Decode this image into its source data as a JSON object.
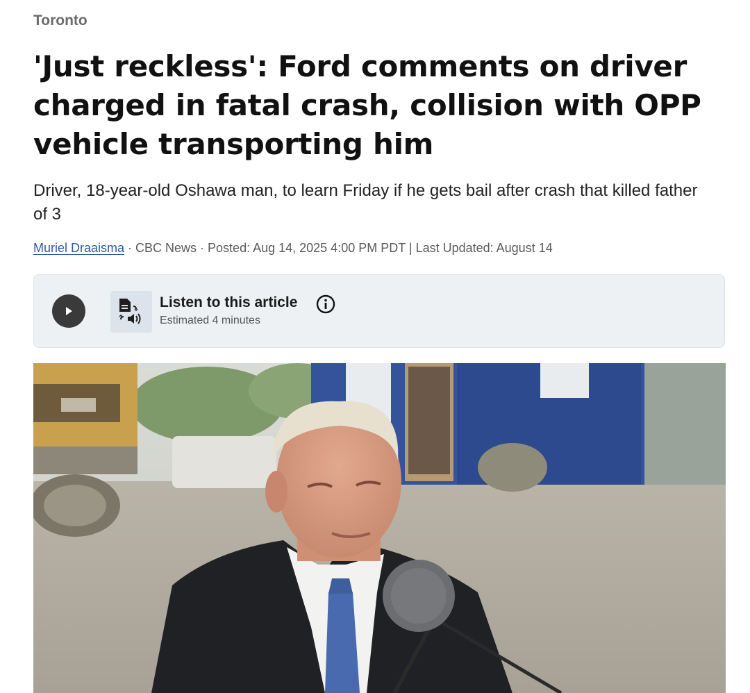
{
  "section": "Toronto",
  "headline": "'Just reckless': Ford comments on driver charged in fatal crash, collision with OPP vehicle transporting him",
  "deck": "Driver, 18-year-old Oshawa man, to learn Friday if he gets bail after crash that killed father of 3",
  "byline": {
    "author": "Muriel Draaisma",
    "rest": " · CBC News · Posted: Aug 14, 2025 4:00 PM PDT | Last Updated: August 14"
  },
  "listen": {
    "title": "Listen to this article",
    "estimate": "Estimated 4 minutes",
    "play_icon": "play-icon",
    "doc_icon": "text-to-speech-icon",
    "info_icon": "info-icon"
  },
  "photo": {
    "subject": "man at microphone outdoors"
  },
  "colors": {
    "link": "#2b5aa8",
    "listen_bg": "#eef1f4",
    "play_btn": "#3a3a3a"
  }
}
